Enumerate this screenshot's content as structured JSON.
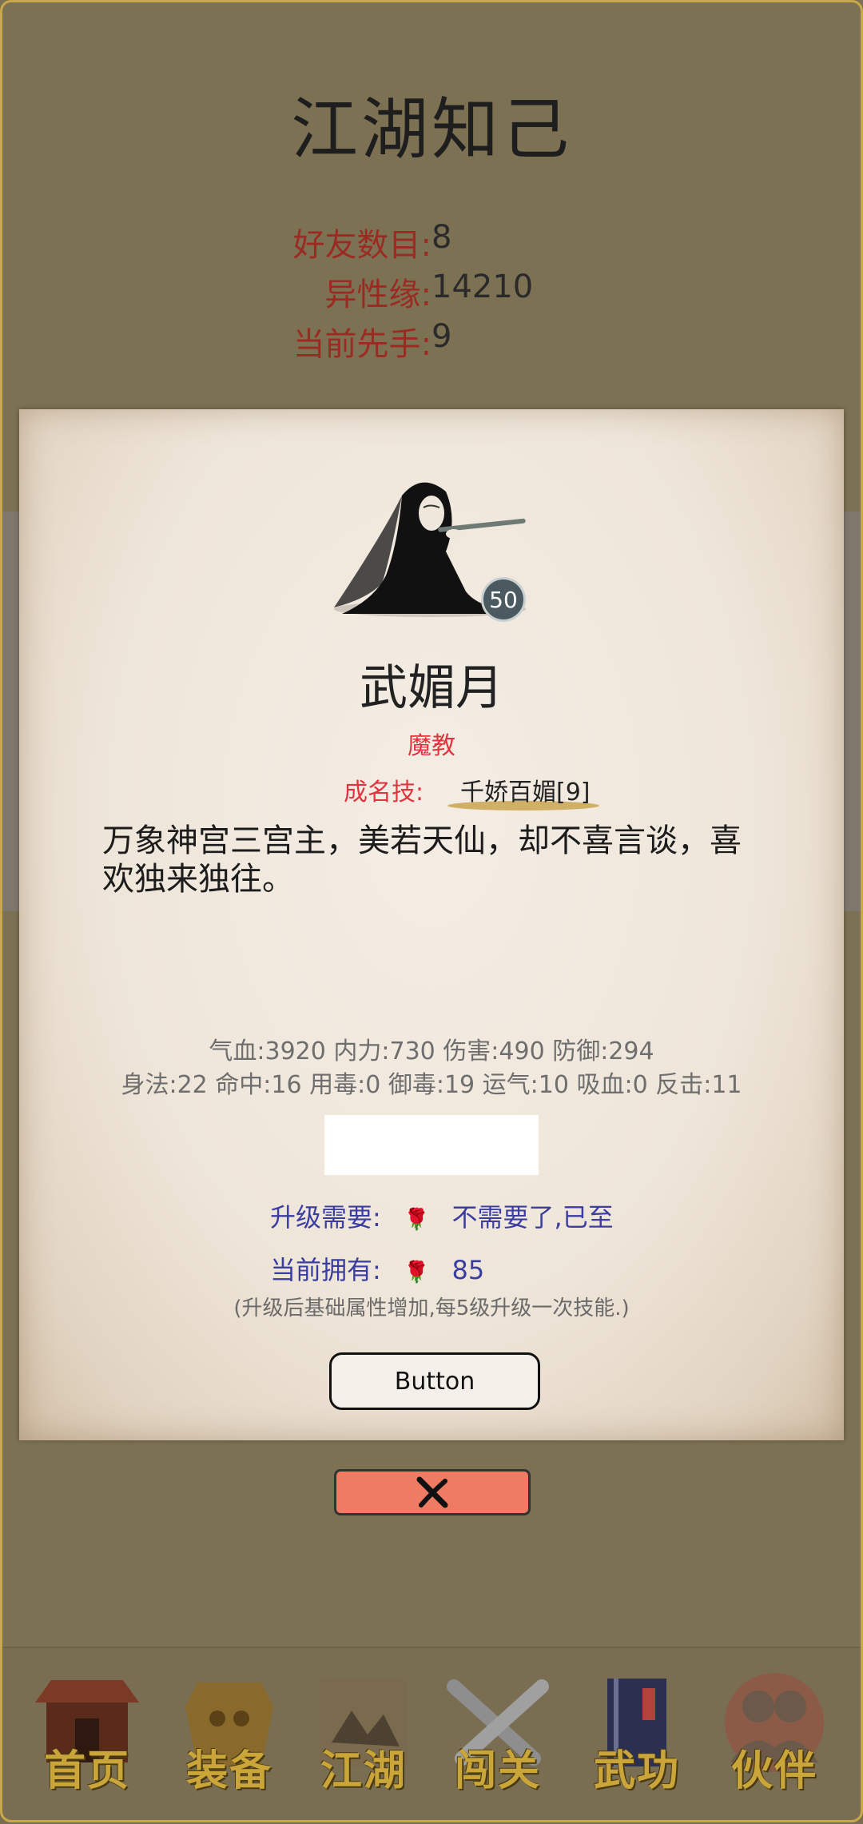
{
  "header": {
    "title": "江湖知己",
    "stats": [
      {
        "label": "好友数目",
        "value": "8"
      },
      {
        "label": "异性缘",
        "value": "14210"
      },
      {
        "label": "当前先手",
        "value": "9"
      }
    ]
  },
  "card": {
    "level": "50",
    "name": "武媚月",
    "faction": "魔教",
    "skill_label": "成名技:",
    "skill_value": "千娇百媚[9]",
    "description": "万象神宫三宫主，美若天仙，却不喜言谈，喜欢独来独往。",
    "attributes_line1": "气血:3920  内力:730  伤害:490  防御:294",
    "attributes_line2": "身法:22  命中:16  用毒:0  御毒:19  运气:10  吸血:0  反击:11",
    "upgrade_need_label": "升级需要:",
    "upgrade_need_value": "不需要了,已至",
    "owned_label": "当前拥有:",
    "owned_value": "85",
    "hint": "(升级后基础属性增加,每5级升级一次技能.)",
    "button_label": "Button",
    "item_icon": "rose-icon"
  },
  "nav": {
    "items": [
      {
        "label": "首页",
        "icon": "house-icon"
      },
      {
        "label": "装备",
        "icon": "armor-icon"
      },
      {
        "label": "江湖",
        "icon": "scroll-icon"
      },
      {
        "label": "闯关",
        "icon": "swords-icon"
      },
      {
        "label": "武功",
        "icon": "book-icon"
      },
      {
        "label": "伙伴",
        "icon": "partners-icon"
      }
    ]
  },
  "colors": {
    "background": "#7d7153",
    "stat_label": "#9b2b22",
    "accent_red": "#e03540",
    "upgrade_text": "#3b3da0",
    "close_button": "#ee7b62",
    "nav_text": "#caa63a"
  }
}
